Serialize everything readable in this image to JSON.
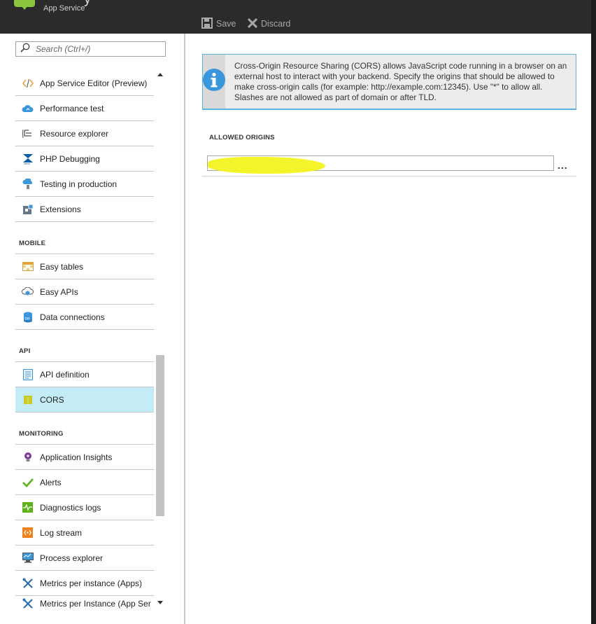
{
  "header": {
    "title_fragment": "y",
    "subtitle": "App Service",
    "toolbar": {
      "save_label": "Save",
      "discard_label": "Discard"
    }
  },
  "search": {
    "placeholder": "Search (Ctrl+/)"
  },
  "sidebar": {
    "items": [
      {
        "label": "App Service Editor (Preview)",
        "icon": "code-icon"
      },
      {
        "label": "Performance test",
        "icon": "cloud-icon"
      },
      {
        "label": "Resource explorer",
        "icon": "list-icon"
      },
      {
        "label": "PHP Debugging",
        "icon": "zend-icon"
      },
      {
        "label": "Testing in production",
        "icon": "beaker-icon"
      },
      {
        "label": "Extensions",
        "icon": "extension-icon"
      }
    ],
    "mobile": {
      "header": "MOBILE",
      "items": [
        {
          "label": "Easy tables",
          "icon": "table-icon"
        },
        {
          "label": "Easy APIs",
          "icon": "api-cloud-icon"
        },
        {
          "label": "Data connections",
          "icon": "database-icon"
        }
      ]
    },
    "api": {
      "header": "API",
      "items": [
        {
          "label": "API definition",
          "icon": "document-icon"
        },
        {
          "label": "CORS",
          "icon": "cors-icon",
          "active": true
        }
      ]
    },
    "monitoring": {
      "header": "MONITORING",
      "items": [
        {
          "label": "Application Insights",
          "icon": "lightbulb-icon"
        },
        {
          "label": "Alerts",
          "icon": "checkmark-icon"
        },
        {
          "label": "Diagnostics logs",
          "icon": "pulse-icon"
        },
        {
          "label": "Log stream",
          "icon": "stream-icon"
        },
        {
          "label": "Process explorer",
          "icon": "monitor-icon"
        },
        {
          "label": "Metrics per instance (Apps)",
          "icon": "tools-icon"
        },
        {
          "label": "Metrics per Instance (App Ser",
          "icon": "tools-icon"
        }
      ]
    }
  },
  "main": {
    "info_text": "Cross-Origin Resource Sharing (CORS) allows JavaScript code running in a browser on an external host to interact with your backend. Specify the origins that should be allowed to make cross-origin calls (for example: http://example.com:12345). Use \"*\" to allow all. Slashes are not allowed as part of domain or after TLD.",
    "allowed_origins_label": "ALLOWED ORIGINS",
    "origin_value": "",
    "more_label": "..."
  },
  "colors": {
    "header_bg": "#2b2b2b",
    "accent_blue": "#59b4d9",
    "active_item_bg": "#c4ecf7",
    "highlight_yellow": "#f3f320",
    "logo_green": "#8cc63f"
  }
}
